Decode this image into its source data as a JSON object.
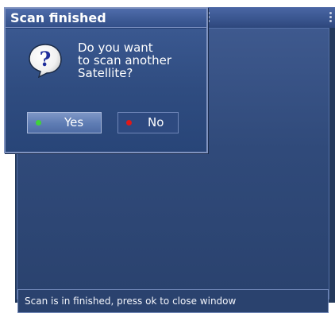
{
  "dialog": {
    "title": "Scan finished",
    "icon": "question-icon",
    "message_lines": [
      "Do you want",
      "to scan another",
      "Satellite?"
    ],
    "buttons": {
      "yes": {
        "label": "Yes",
        "indicator_color": "#3fd23a"
      },
      "no": {
        "label": "No",
        "indicator_color": "#e01818"
      }
    }
  },
  "status_bar": {
    "text": "Scan is in finished, press ok to close window"
  },
  "colors": {
    "panel_background": "#2f4a7c",
    "title_bar": "#3d5a95",
    "selected_button": "#5e7cb3"
  }
}
